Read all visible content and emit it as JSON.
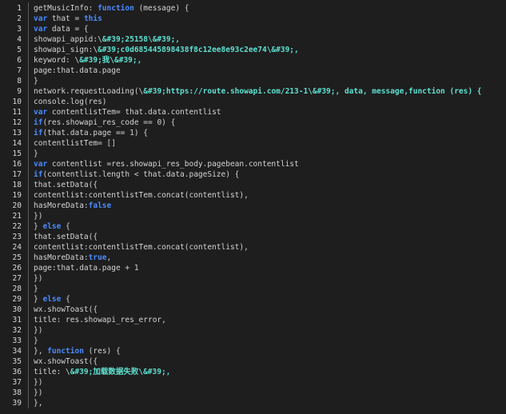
{
  "colors": {
    "background": "#1e1e1e",
    "keyword": "#4a8bff",
    "string": "#5ee0d0",
    "text": "#d4d4d4",
    "line_number": "#d8d8d8"
  },
  "lines": [
    {
      "n": "1",
      "tokens": [
        [
          "p",
          "getMusicInfo: "
        ],
        [
          "k",
          "function"
        ],
        [
          "p",
          " (message) {"
        ]
      ]
    },
    {
      "n": "2",
      "tokens": [
        [
          "k",
          "var"
        ],
        [
          "p",
          " that = "
        ],
        [
          "k",
          "this"
        ]
      ]
    },
    {
      "n": "3",
      "tokens": [
        [
          "k",
          "var"
        ],
        [
          "p",
          " data = {"
        ]
      ]
    },
    {
      "n": "4",
      "tokens": [
        [
          "p",
          "showapi_appid:\\"
        ],
        [
          "s",
          "&#39;25158\\&#39;,"
        ]
      ]
    },
    {
      "n": "5",
      "tokens": [
        [
          "p",
          "showapi_sign:\\"
        ],
        [
          "s",
          "&#39;c0d685445898438f8c12ee8e93c2ee74\\&#39;,"
        ]
      ]
    },
    {
      "n": "6",
      "tokens": [
        [
          "p",
          "keyword: \\"
        ],
        [
          "s",
          "&#39;我\\&#39;,"
        ]
      ]
    },
    {
      "n": "7",
      "tokens": [
        [
          "p",
          "page:that.data.page"
        ]
      ]
    },
    {
      "n": "8",
      "tokens": [
        [
          "p",
          "}"
        ]
      ]
    },
    {
      "n": "9",
      "tokens": [
        [
          "p",
          "network.requestLoading(\\"
        ],
        [
          "s",
          "&#39;https://route.showapi.com/213-1\\&#39;, data, message,function (res) {"
        ]
      ]
    },
    {
      "n": "10",
      "tokens": [
        [
          "p",
          "console.log(res)"
        ]
      ]
    },
    {
      "n": "11",
      "tokens": [
        [
          "k",
          "var"
        ],
        [
          "p",
          " contentlistTem= that.data.contentlist"
        ]
      ]
    },
    {
      "n": "12",
      "tokens": [
        [
          "k",
          "if"
        ],
        [
          "p",
          "(res.showapi_res_code == 0) {"
        ]
      ]
    },
    {
      "n": "13",
      "tokens": [
        [
          "k",
          "if"
        ],
        [
          "p",
          "(that.data.page == 1) {"
        ]
      ]
    },
    {
      "n": "14",
      "tokens": [
        [
          "p",
          "contentlistTem= []"
        ]
      ]
    },
    {
      "n": "15",
      "tokens": [
        [
          "p",
          "}"
        ]
      ]
    },
    {
      "n": "16",
      "tokens": [
        [
          "k",
          "var"
        ],
        [
          "p",
          " contentlist =res.showapi_res_body.pagebean.contentlist"
        ]
      ]
    },
    {
      "n": "17",
      "tokens": [
        [
          "k",
          "if"
        ],
        [
          "p",
          "(contentlist.length < that.data.pageSize) {"
        ]
      ]
    },
    {
      "n": "18",
      "tokens": [
        [
          "p",
          "that.setData({"
        ]
      ]
    },
    {
      "n": "19",
      "tokens": [
        [
          "p",
          "contentlist:contentlistTem.concat(contentlist),"
        ]
      ]
    },
    {
      "n": "20",
      "tokens": [
        [
          "p",
          "hasMoreData:"
        ],
        [
          "k",
          "false"
        ]
      ]
    },
    {
      "n": "21",
      "tokens": [
        [
          "p",
          "})"
        ]
      ]
    },
    {
      "n": "22",
      "tokens": [
        [
          "p",
          "} "
        ],
        [
          "k",
          "else"
        ],
        [
          "p",
          " {"
        ]
      ]
    },
    {
      "n": "23",
      "tokens": [
        [
          "p",
          "that.setData({"
        ]
      ]
    },
    {
      "n": "24",
      "tokens": [
        [
          "p",
          "contentlist:contentlistTem.concat(contentlist),"
        ]
      ]
    },
    {
      "n": "25",
      "tokens": [
        [
          "p",
          "hasMoreData:"
        ],
        [
          "k",
          "true"
        ],
        [
          "p",
          ","
        ]
      ]
    },
    {
      "n": "26",
      "tokens": [
        [
          "p",
          "page:that.data.page + 1"
        ]
      ]
    },
    {
      "n": "27",
      "tokens": [
        [
          "p",
          "})"
        ]
      ]
    },
    {
      "n": "28",
      "tokens": [
        [
          "p",
          "}"
        ]
      ]
    },
    {
      "n": "29",
      "tokens": [
        [
          "p",
          "} "
        ],
        [
          "k",
          "else"
        ],
        [
          "p",
          " {"
        ]
      ]
    },
    {
      "n": "30",
      "tokens": [
        [
          "p",
          "wx.showToast({"
        ]
      ]
    },
    {
      "n": "31",
      "tokens": [
        [
          "p",
          "title: res.showapi_res_error,"
        ]
      ]
    },
    {
      "n": "32",
      "tokens": [
        [
          "p",
          "})"
        ]
      ]
    },
    {
      "n": "33",
      "tokens": [
        [
          "p",
          "}"
        ]
      ]
    },
    {
      "n": "34",
      "tokens": [
        [
          "p",
          "}, "
        ],
        [
          "k",
          "function"
        ],
        [
          "p",
          " (res) {"
        ]
      ]
    },
    {
      "n": "35",
      "tokens": [
        [
          "p",
          "wx.showToast({"
        ]
      ]
    },
    {
      "n": "36",
      "tokens": [
        [
          "p",
          "title: \\"
        ],
        [
          "s",
          "&#39;加载数据失败\\&#39;,"
        ]
      ]
    },
    {
      "n": "37",
      "tokens": [
        [
          "p",
          "})"
        ]
      ]
    },
    {
      "n": "38",
      "tokens": [
        [
          "p",
          "})"
        ]
      ]
    },
    {
      "n": "39",
      "tokens": [
        [
          "p",
          "},"
        ]
      ]
    }
  ]
}
